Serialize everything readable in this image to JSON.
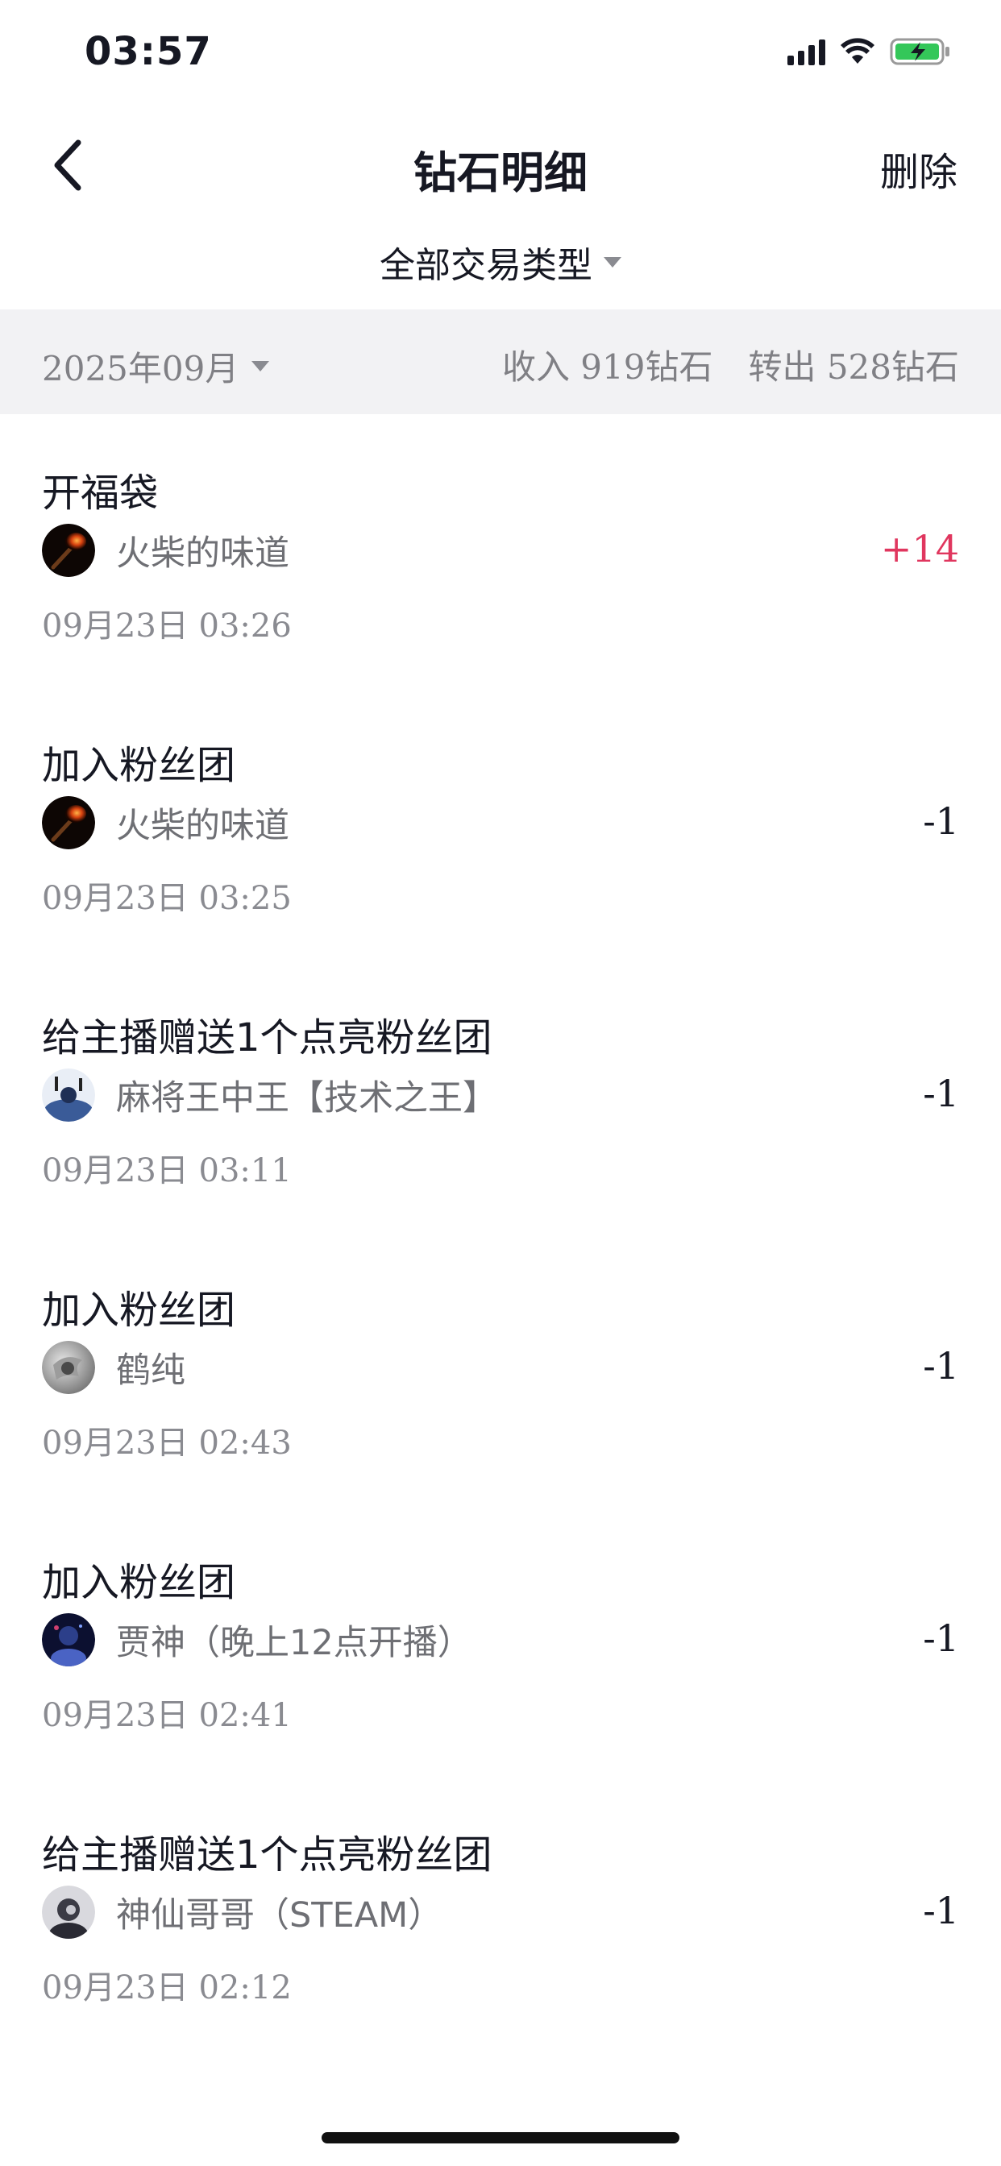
{
  "status_bar": {
    "time": "03:57"
  },
  "header": {
    "title": "钻石明细",
    "action_label": "删除"
  },
  "filter": {
    "label": "全部交易类型"
  },
  "summary": {
    "month": "2025年09月",
    "income": "收入 919钻石",
    "outgo": "转出 528钻石"
  },
  "colors": {
    "positive": "#e0365e",
    "summary_bg": "#f2f2f4",
    "battery": "#34c759"
  },
  "records": [
    {
      "title": "开福袋",
      "user": "火柴的味道",
      "amount": "+14",
      "time": "09月23日 03:26",
      "avatar_icon": "match-flame-avatar"
    },
    {
      "title": "加入粉丝团",
      "user": "火柴的味道",
      "amount": "-1",
      "time": "09月23日 03:25",
      "avatar_icon": "match-flame-avatar"
    },
    {
      "title": "给主播赠送1个点亮粉丝团",
      "user": "麻将王中王【技术之王】",
      "amount": "-1",
      "time": "09月23日 03:11",
      "avatar_icon": "mahjong-king-avatar"
    },
    {
      "title": "加入粉丝团",
      "user": "鹤纯",
      "amount": "-1",
      "time": "09月23日 02:43",
      "avatar_icon": "grey-portrait-avatar"
    },
    {
      "title": "加入粉丝团",
      "user": "贾神（晚上12点开播）",
      "amount": "-1",
      "time": "09月23日 02:41",
      "avatar_icon": "dark-blue-avatar"
    },
    {
      "title": "给主播赠送1个点亮粉丝团",
      "user": "神仙哥哥（STEAM）",
      "amount": "-1",
      "time": "09月23日 02:12",
      "avatar_icon": "dark-portrait-avatar"
    }
  ]
}
